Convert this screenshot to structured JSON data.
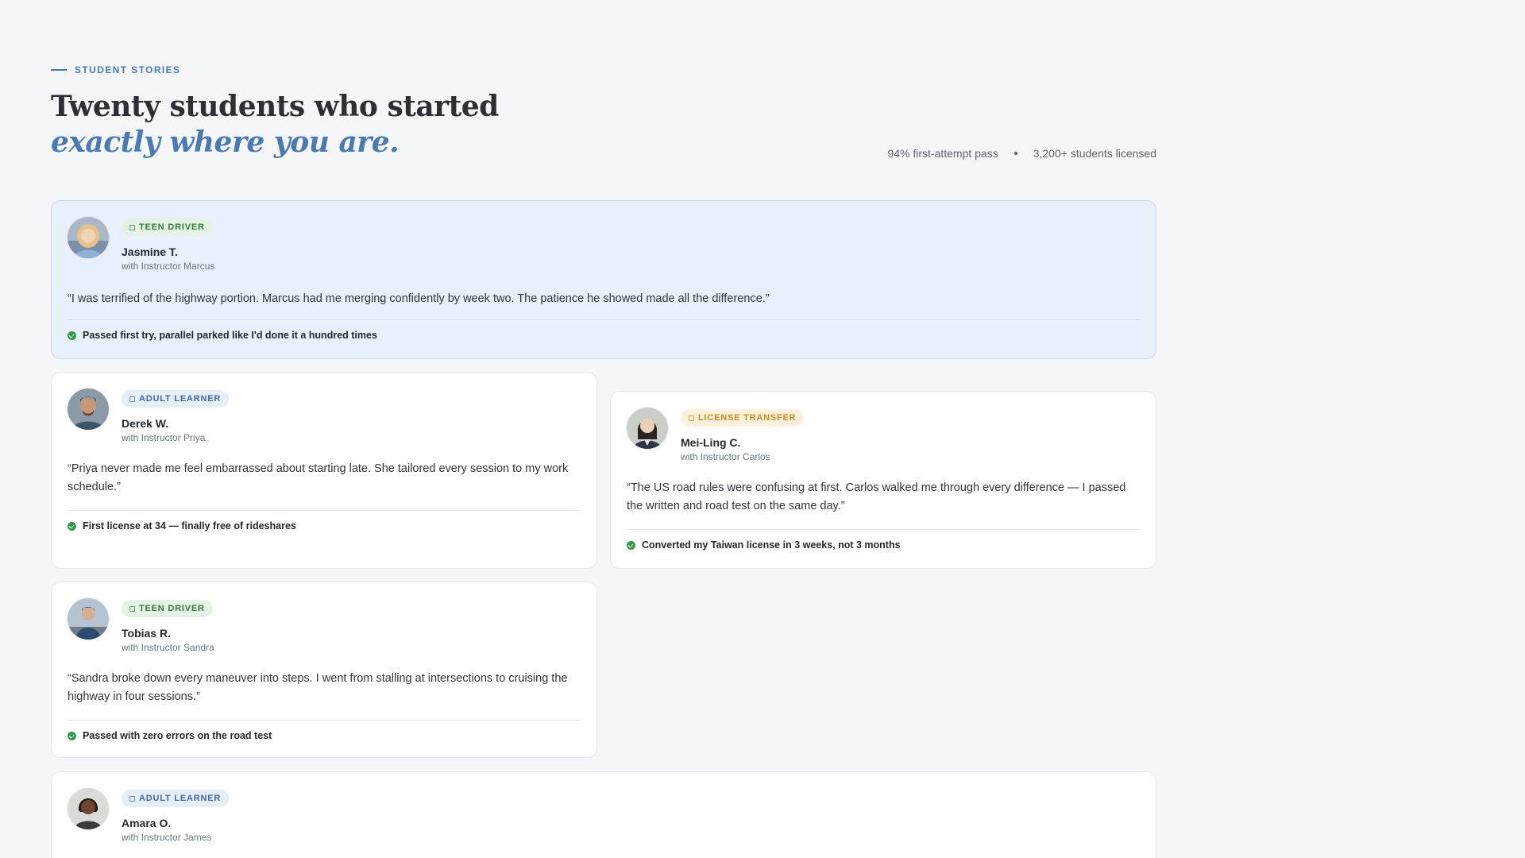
{
  "section": {
    "eyebrow": "STUDENT STORIES",
    "headline_line1": "Twenty students who started",
    "headline_line2": "exactly where you are."
  },
  "stats": {
    "pass_rate": "94% first-attempt pass",
    "licensed": "3,200+ students licensed"
  },
  "testimonials": [
    {
      "badge": "TEEN DRIVER",
      "badge_type": "teen",
      "name": "Jasmine T.",
      "instructor": "with Instructor Marcus",
      "quote": "“I was terrified of the highway portion. Marcus had me merging confidently by week two. The patience he showed made all the difference.”",
      "outcome": "Passed first try, parallel parked like I'd done it a hundred times",
      "featured": true
    },
    {
      "badge": "ADULT LEARNER",
      "badge_type": "adult",
      "name": "Derek W.",
      "instructor": "with Instructor Priya",
      "quote": "“Priya never made me feel embarrassed about starting late. She tailored every session to my work schedule.”",
      "outcome": "First license at 34 — finally free of rideshares"
    },
    {
      "badge": "LICENSE TRANSFER",
      "badge_type": "transfer",
      "name": "Mei-Ling C.",
      "instructor": "with Instructor Carlos",
      "quote": "“The US road rules were confusing at first. Carlos walked me through every difference — I passed the written and road test on the same day.”",
      "outcome": "Converted my Taiwan license in 3 weeks, not 3 months"
    },
    {
      "badge": "TEEN DRIVER",
      "badge_type": "teen",
      "name": "Tobias R.",
      "instructor": "with Instructor Sandra",
      "quote": "“Sandra broke down every maneuver into steps. I went from stalling at intersections to cruising the highway in four sessions.”",
      "outcome": "Passed with zero errors on the road test"
    },
    {
      "badge": "ADULT LEARNER",
      "badge_type": "adult",
      "name": "Amara O.",
      "instructor": "with Instructor James"
    }
  ],
  "colors": {
    "accent": "#4a7ab4",
    "featured_bg": "#e8f0fb",
    "success": "#2f9a4c",
    "teen_badge": "#2f7a3c",
    "adult_badge": "#3f6aa3",
    "transfer_badge": "#c98a1b"
  }
}
